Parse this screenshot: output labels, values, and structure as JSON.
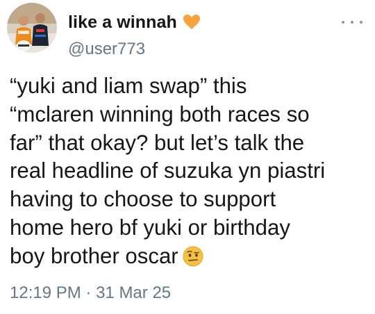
{
  "author": {
    "display_name": "like a winnah",
    "name_emoji": "orange-heart-icon",
    "handle": "@user773",
    "avatar": "avatar-photo"
  },
  "tweet": {
    "lines": [
      "“yuki and liam swap” this",
      "“mclaren winning both races so",
      "far” that okay? but let’s talk the",
      "real headline of suzuka yn piastri",
      "having to choose to support",
      "home hero bf yuki or birthday",
      "boy brother oscar"
    ],
    "trailing_emoji": "raised-eyebrow-face-icon"
  },
  "meta": {
    "time": "12:19 PM",
    "separator": "·",
    "date": "31 Mar 25"
  },
  "colors": {
    "text": "#14171a",
    "secondary": "#657786",
    "heart": "#f7a23b",
    "emoji_face": "#f4c142"
  }
}
